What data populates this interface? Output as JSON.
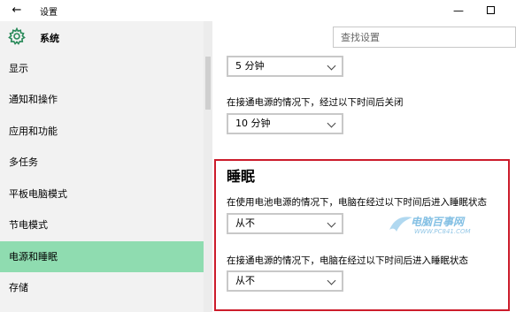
{
  "window": {
    "back_glyph": "←",
    "title": "设置",
    "minimize_glyph": "—"
  },
  "sidebar": {
    "header_label": "系统",
    "items": [
      {
        "label": "显示",
        "active": false
      },
      {
        "label": "通知和操作",
        "active": false
      },
      {
        "label": "应用和功能",
        "active": false
      },
      {
        "label": "多任务",
        "active": false
      },
      {
        "label": "平板电脑模式",
        "active": false
      },
      {
        "label": "节电模式",
        "active": false
      },
      {
        "label": "电源和睡眠",
        "active": true
      },
      {
        "label": "存储",
        "active": false
      }
    ]
  },
  "search": {
    "placeholder": "查找设置"
  },
  "screen": {
    "battery_timeout_value": "5 分钟",
    "plugged_desc": "在接通电源的情况下，经过以下时间后关闭",
    "plugged_timeout_value": "10 分钟"
  },
  "sleep": {
    "title": "睡眠",
    "battery_desc": "在使用电池电源的情况下，电脑在经过以下时间后进入睡眠状态",
    "battery_value": "从不",
    "plugged_desc": "在接通电源的情况下，电脑在经过以下时间后进入睡眠状态",
    "plugged_value": "从不"
  },
  "watermark": {
    "text": "电脑百事网",
    "url": "WWW.PC841.COM"
  },
  "colors": {
    "active_nav": "#8fdcb0",
    "highlight_border": "#cc1c2b",
    "gear": "#2a8a5a"
  }
}
